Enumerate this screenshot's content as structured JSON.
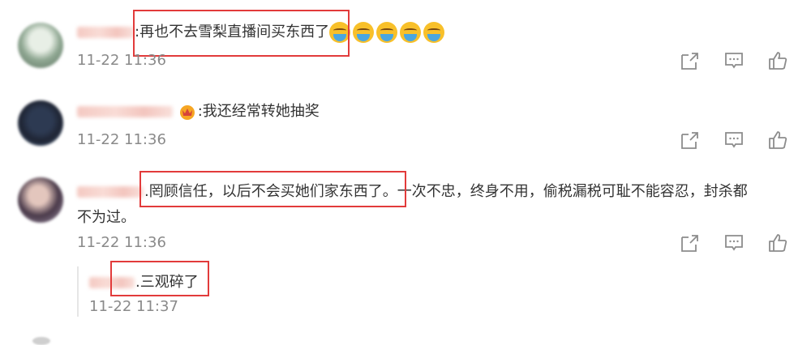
{
  "comments": [
    {
      "text": ":再也不去雪梨直播间买东西了",
      "time": "11-22 11:36",
      "emoji_count": 5,
      "emoji_icon": "crying-emoji-icon"
    },
    {
      "text": ":我还经常转她抽奖",
      "time": "11-22 11:36",
      "badge_icon": "crown-badge-icon"
    },
    {
      "text_highlighted": ".罔顾信任，以后不会买她们家东西了。",
      "text_rest": "一次不忠，终身不用，偷税漏税可耻不能容忍，封杀都",
      "text_line2": "不为过。",
      "time": "11-22 11:36",
      "reply": {
        "text": ".三观碎了",
        "time": "11-22 11:37"
      }
    }
  ],
  "actions": [
    "share-icon",
    "comment-icon",
    "like-icon"
  ],
  "colors": {
    "highlight_border": "#e23b3b",
    "timestamp": "#8a8a8a",
    "text": "#333333",
    "name_blur": "#f4c9c2"
  }
}
